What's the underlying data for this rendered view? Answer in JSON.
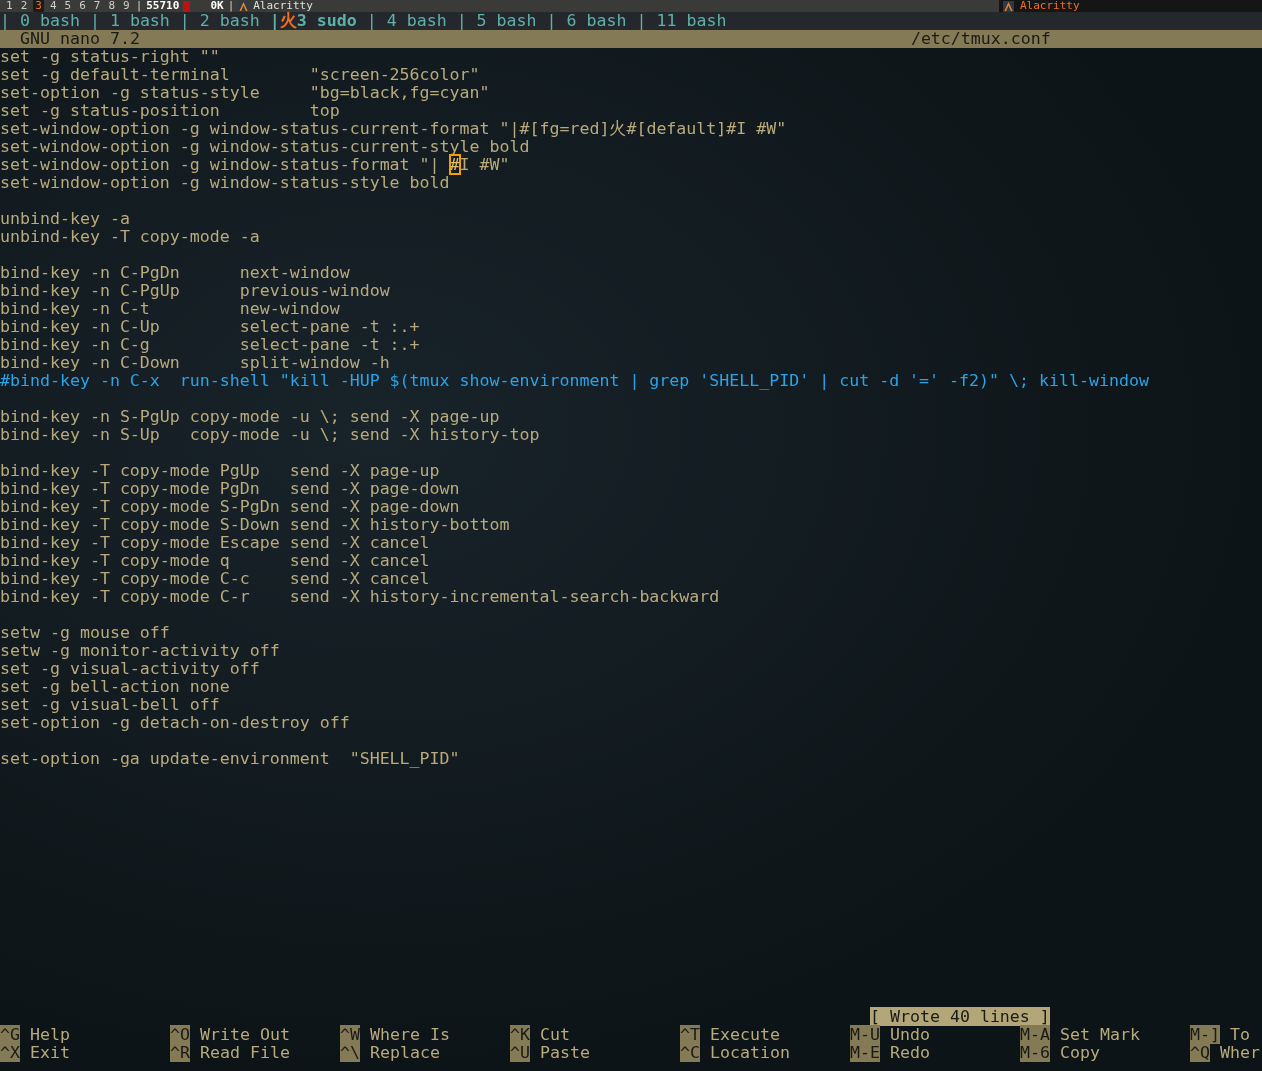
{
  "top_bar": {
    "workspaces": [
      {
        "label": "1",
        "selected": false
      },
      {
        "label": "2",
        "selected": false
      },
      {
        "label": "3",
        "selected": true
      },
      {
        "label": "4",
        "selected": false
      },
      {
        "label": "5",
        "selected": false
      },
      {
        "label": "6",
        "selected": false
      },
      {
        "label": "7",
        "selected": false
      },
      {
        "label": "8",
        "selected": false
      },
      {
        "label": "9",
        "selected": false
      }
    ],
    "separator": "|",
    "counter": "55710",
    "indicator_on": true,
    "rate": "0K",
    "rate_separator": "|",
    "window_title": "Alacritty",
    "right_title": "Alacritty"
  },
  "tmux_status": {
    "windows": [
      {
        "prefix": "|",
        "label": "0 bash",
        "selected": false
      },
      {
        "prefix": "|",
        "label": "1 bash",
        "selected": false
      },
      {
        "prefix": "|",
        "label": "2 bash",
        "selected": false
      },
      {
        "prefix": "|",
        "flag": "火",
        "label": "3 sudo",
        "selected": true
      },
      {
        "prefix": "|",
        "label": "4 bash",
        "selected": false
      },
      {
        "prefix": "|",
        "label": "5 bash",
        "selected": false
      },
      {
        "prefix": "|",
        "label": "6 bash",
        "selected": false
      },
      {
        "prefix": "|",
        "label": "11 bash",
        "selected": false
      }
    ]
  },
  "nano": {
    "version": "GNU nano 7.2",
    "file": "/etc/tmux.conf",
    "lines": [
      {
        "kind": "code",
        "text": "set -g status-right \"\""
      },
      {
        "kind": "code",
        "text": "set -g default-terminal        \"screen-256color\""
      },
      {
        "kind": "code",
        "text": "set-option -g status-style     \"bg=black,fg=cyan\""
      },
      {
        "kind": "code",
        "text": "set -g status-position         top"
      },
      {
        "kind": "code",
        "text": "set-window-option -g window-status-current-format \"|#[fg=red]火#[default]#I #W\""
      },
      {
        "kind": "code",
        "text": "set-window-option -g window-status-current-style bold"
      },
      {
        "kind": "cursor",
        "before": "set-window-option -g window-status-format \"| ",
        "cursor": "#",
        "after": "I #W\""
      },
      {
        "kind": "code",
        "text": "set-window-option -g window-status-style bold"
      },
      {
        "kind": "blank"
      },
      {
        "kind": "code",
        "text": "unbind-key -a"
      },
      {
        "kind": "code",
        "text": "unbind-key -T copy-mode -a"
      },
      {
        "kind": "blank"
      },
      {
        "kind": "code",
        "text": "bind-key -n C-PgDn      next-window"
      },
      {
        "kind": "code",
        "text": "bind-key -n C-PgUp      previous-window"
      },
      {
        "kind": "code",
        "text": "bind-key -n C-t         new-window"
      },
      {
        "kind": "code",
        "text": "bind-key -n C-Up        select-pane -t :.+"
      },
      {
        "kind": "code",
        "text": "bind-key -n C-g         select-pane -t :.+"
      },
      {
        "kind": "code",
        "text": "bind-key -n C-Down      split-window -h"
      },
      {
        "kind": "comment",
        "text": "#bind-key -n C-x  run-shell \"kill -HUP $(tmux show-environment | grep 'SHELL_PID' | cut -d '=' -f2)\" \\; kill-window"
      },
      {
        "kind": "blank"
      },
      {
        "kind": "code",
        "text": "bind-key -n S-PgUp copy-mode -u \\; send -X page-up"
      },
      {
        "kind": "code",
        "text": "bind-key -n S-Up   copy-mode -u \\; send -X history-top"
      },
      {
        "kind": "blank"
      },
      {
        "kind": "code",
        "text": "bind-key -T copy-mode PgUp   send -X page-up"
      },
      {
        "kind": "code",
        "text": "bind-key -T copy-mode PgDn   send -X page-down"
      },
      {
        "kind": "code",
        "text": "bind-key -T copy-mode S-PgDn send -X page-down"
      },
      {
        "kind": "code",
        "text": "bind-key -T copy-mode S-Down send -X history-bottom"
      },
      {
        "kind": "code",
        "text": "bind-key -T copy-mode Escape send -X cancel"
      },
      {
        "kind": "code",
        "text": "bind-key -T copy-mode q      send -X cancel"
      },
      {
        "kind": "code",
        "text": "bind-key -T copy-mode C-c    send -X cancel"
      },
      {
        "kind": "code",
        "text": "bind-key -T copy-mode C-r    send -X history-incremental-search-backward"
      },
      {
        "kind": "blank"
      },
      {
        "kind": "code",
        "text": "setw -g mouse off"
      },
      {
        "kind": "code",
        "text": "setw -g monitor-activity off"
      },
      {
        "kind": "code",
        "text": "set -g visual-activity off"
      },
      {
        "kind": "code",
        "text": "set -g bell-action none"
      },
      {
        "kind": "code",
        "text": "set -g visual-bell off"
      },
      {
        "kind": "code",
        "text": "set-option -g detach-on-destroy off"
      },
      {
        "kind": "blank"
      },
      {
        "kind": "code",
        "text": "set-option -ga update-environment  \"SHELL_PID\""
      }
    ],
    "message": "[ Wrote 40 lines ]",
    "shortcuts": [
      [
        {
          "key": "^G",
          "label": "Help"
        },
        {
          "key": "^X",
          "label": "Exit"
        }
      ],
      [
        {
          "key": "^O",
          "label": "Write Out"
        },
        {
          "key": "^R",
          "label": "Read File"
        }
      ],
      [
        {
          "key": "^W",
          "label": "Where Is"
        },
        {
          "key": "^\\",
          "label": "Replace"
        }
      ],
      [
        {
          "key": "^K",
          "label": "Cut"
        },
        {
          "key": "^U",
          "label": "Paste"
        }
      ],
      [
        {
          "key": "^T",
          "label": "Execute"
        },
        {
          "key": "^C",
          "label": "Location"
        }
      ],
      [
        {
          "key": "M-U",
          "label": "Undo"
        },
        {
          "key": "M-E",
          "label": "Redo"
        }
      ],
      [
        {
          "key": "M-A",
          "label": "Set Mark"
        },
        {
          "key": "M-6",
          "label": "Copy"
        }
      ],
      [
        {
          "key": "M-]",
          "label": "To"
        },
        {
          "key": "^Q",
          "label": "Wher"
        }
      ]
    ]
  }
}
